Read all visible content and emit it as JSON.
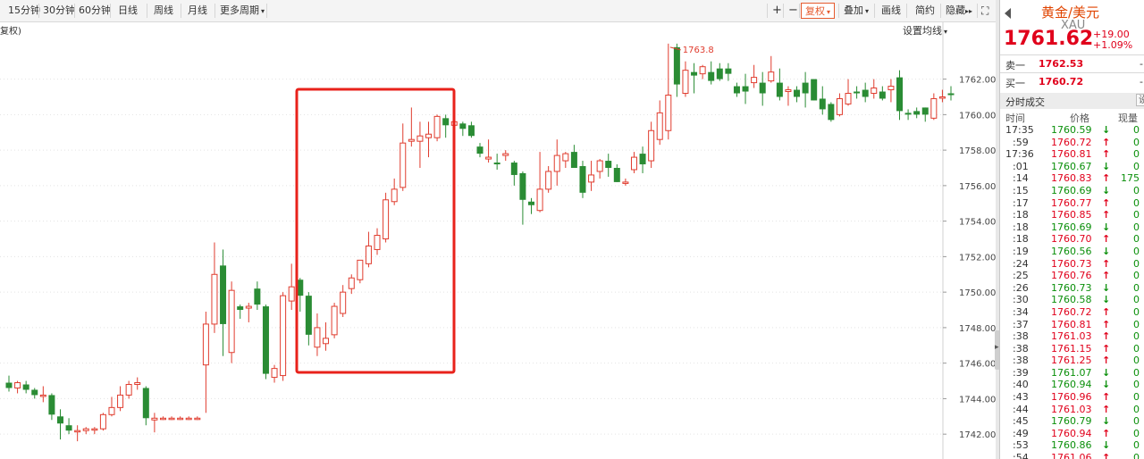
{
  "toolbar": {
    "left_tabs": [
      {
        "label": "15分钟"
      },
      {
        "label": "30分钟"
      },
      {
        "label": "60分钟"
      },
      {
        "label": "日线"
      },
      {
        "label": "周线"
      },
      {
        "label": "月线"
      },
      {
        "label": "更多周期"
      }
    ],
    "plus_label": "+",
    "minus_label": "−",
    "restore_label": "复权",
    "overlay_label": "叠加",
    "draw_label": "画线",
    "simple_label": "简约",
    "hide_label": "隐藏",
    "caret": "▾",
    "forward_glyph": "▸▸",
    "fullscreen_glyph": "⛶"
  },
  "chart": {
    "restore_tag": "复权)",
    "ma_setting": "设置均线",
    "max_label": "1763.8",
    "highlight_color": "#e8221b",
    "up_color": "#e03c2e",
    "down_color": "#2a8c34"
  },
  "chart_data": {
    "type": "candlestick",
    "y_axis": {
      "min": 1740.6,
      "max": 1765.2,
      "ticks": [
        1762,
        1760,
        1758,
        1756,
        1754,
        1752,
        1750,
        1748,
        1746,
        1744,
        1742
      ]
    },
    "ohlc": [
      [
        1744.9,
        1745.3,
        1744.4,
        1744.6
      ],
      [
        1744.6,
        1745.0,
        1744.3,
        1744.9
      ],
      [
        1744.8,
        1745.0,
        1744.3,
        1744.5
      ],
      [
        1744.5,
        1744.6,
        1744.0,
        1744.2
      ],
      [
        1744.2,
        1744.7,
        1743.8,
        1744.2
      ],
      [
        1744.2,
        1744.3,
        1742.8,
        1743.1
      ],
      [
        1743.0,
        1743.4,
        1741.7,
        1742.6
      ],
      [
        1742.5,
        1742.9,
        1742.0,
        1742.2
      ],
      [
        1742.2,
        1742.5,
        1741.6,
        1742.2
      ],
      [
        1742.2,
        1742.4,
        1742.0,
        1742.3
      ],
      [
        1742.3,
        1742.4,
        1742.0,
        1742.3
      ],
      [
        1742.3,
        1743.2,
        1742.2,
        1743.1
      ],
      [
        1743.1,
        1744.1,
        1743.0,
        1743.5
      ],
      [
        1743.5,
        1744.7,
        1743.3,
        1744.2
      ],
      [
        1744.2,
        1745.0,
        1744.0,
        1744.8
      ],
      [
        1744.8,
        1745.2,
        1744.5,
        1744.9
      ],
      [
        1744.6,
        1744.7,
        1742.5,
        1742.9
      ],
      [
        1742.8,
        1743.2,
        1742.1,
        1742.9
      ],
      [
        1742.9,
        1743.0,
        1742.8,
        1742.9
      ],
      [
        1742.9,
        1743.0,
        1742.8,
        1742.9
      ],
      [
        1742.9,
        1743.0,
        1742.8,
        1742.9
      ],
      [
        1742.9,
        1743.0,
        1742.8,
        1742.9
      ],
      [
        1742.9,
        1743.0,
        1742.8,
        1742.9
      ],
      [
        1745.9,
        1748.9,
        1743.2,
        1748.2
      ],
      [
        1748.2,
        1752.8,
        1747.7,
        1751.0
      ],
      [
        1751.5,
        1752.4,
        1746.4,
        1748.2
      ],
      [
        1746.6,
        1750.6,
        1746.0,
        1750.1
      ],
      [
        1749.2,
        1749.3,
        1748.5,
        1749.0
      ],
      [
        1749.1,
        1749.4,
        1748.3,
        1749.2
      ],
      [
        1750.2,
        1750.6,
        1749.0,
        1749.3
      ],
      [
        1749.2,
        1749.3,
        1745.1,
        1745.4
      ],
      [
        1745.2,
        1745.9,
        1744.9,
        1745.7
      ],
      [
        1745.3,
        1750.0,
        1745.0,
        1749.8
      ],
      [
        1749.5,
        1751.6,
        1749.0,
        1750.3
      ],
      [
        1750.7,
        1750.8,
        1748.9,
        1749.8
      ],
      [
        1749.8,
        1750.0,
        1747.0,
        1747.6
      ],
      [
        1746.9,
        1748.8,
        1746.4,
        1748.0
      ],
      [
        1747.1,
        1748.3,
        1746.7,
        1747.4
      ],
      [
        1747.6,
        1749.4,
        1747.4,
        1749.2
      ],
      [
        1748.8,
        1750.4,
        1748.6,
        1750.0
      ],
      [
        1750.2,
        1751.0,
        1749.9,
        1750.8
      ],
      [
        1750.7,
        1751.8,
        1750.5,
        1751.8
      ],
      [
        1751.6,
        1753.4,
        1751.4,
        1752.6
      ],
      [
        1752.4,
        1753.6,
        1752.1,
        1753.2
      ],
      [
        1753.0,
        1755.6,
        1752.8,
        1755.2
      ],
      [
        1755.1,
        1756.4,
        1754.9,
        1755.8
      ],
      [
        1755.9,
        1759.5,
        1755.7,
        1758.4
      ],
      [
        1758.5,
        1760.4,
        1758.2,
        1758.6
      ],
      [
        1758.5,
        1759.6,
        1757.0,
        1758.8
      ],
      [
        1758.7,
        1759.6,
        1757.6,
        1758.9
      ],
      [
        1758.7,
        1760.0,
        1758.5,
        1759.9
      ],
      [
        1759.8,
        1760.0,
        1758.7,
        1759.4
      ],
      [
        1759.4,
        1759.9,
        1759.0,
        1759.6
      ],
      [
        1759.5,
        1759.6,
        1758.8,
        1759.2
      ],
      [
        1759.4,
        1759.6,
        1758.7,
        1758.8
      ],
      [
        1758.2,
        1758.4,
        1757.6,
        1757.8
      ],
      [
        1757.5,
        1758.6,
        1757.3,
        1757.6
      ],
      [
        1757.3,
        1757.8,
        1756.9,
        1757.2
      ],
      [
        1757.7,
        1758.0,
        1757.4,
        1757.8
      ],
      [
        1757.3,
        1757.4,
        1756.0,
        1756.6
      ],
      [
        1756.7,
        1756.8,
        1753.8,
        1755.2
      ],
      [
        1755.1,
        1755.3,
        1754.4,
        1754.9
      ],
      [
        1754.6,
        1757.9,
        1754.5,
        1755.8
      ],
      [
        1755.8,
        1757.1,
        1755.6,
        1756.8
      ],
      [
        1756.8,
        1758.6,
        1756.0,
        1757.7
      ],
      [
        1757.4,
        1757.9,
        1757.0,
        1757.8
      ],
      [
        1757.9,
        1758.3,
        1757.0,
        1757.0
      ],
      [
        1757.1,
        1757.4,
        1755.3,
        1755.6
      ],
      [
        1756.2,
        1757.4,
        1755.7,
        1756.6
      ],
      [
        1756.8,
        1757.5,
        1756.4,
        1757.4
      ],
      [
        1757.4,
        1757.8,
        1756.5,
        1757.0
      ],
      [
        1757.0,
        1757.2,
        1756.2,
        1756.2
      ],
      [
        1756.2,
        1756.4,
        1756.0,
        1756.2
      ],
      [
        1756.9,
        1757.9,
        1756.7,
        1757.6
      ],
      [
        1757.8,
        1758.2,
        1756.7,
        1757.2
      ],
      [
        1757.4,
        1759.6,
        1757.0,
        1759.1
      ],
      [
        1758.6,
        1760.8,
        1758.3,
        1760.1
      ],
      [
        1759.1,
        1764.0,
        1758.6,
        1761.1
      ],
      [
        1763.8,
        1764.0,
        1761.0,
        1761.7
      ],
      [
        1761.2,
        1763.0,
        1761.0,
        1762.5
      ],
      [
        1762.4,
        1762.9,
        1761.2,
        1762.2
      ],
      [
        1762.3,
        1762.8,
        1762.0,
        1762.7
      ],
      [
        1762.4,
        1763.0,
        1761.7,
        1761.9
      ],
      [
        1762.6,
        1762.9,
        1761.9,
        1762.0
      ],
      [
        1762.6,
        1762.9,
        1761.9,
        1762.3
      ],
      [
        1761.6,
        1761.8,
        1761.0,
        1761.2
      ],
      [
        1761.6,
        1762.3,
        1760.6,
        1761.3
      ],
      [
        1761.8,
        1762.8,
        1761.5,
        1762.1
      ],
      [
        1761.8,
        1762.4,
        1760.5,
        1761.2
      ],
      [
        1761.9,
        1763.3,
        1761.8,
        1762.4
      ],
      [
        1761.8,
        1762.6,
        1760.8,
        1761.0
      ],
      [
        1761.3,
        1761.6,
        1760.5,
        1761.4
      ],
      [
        1761.4,
        1761.6,
        1760.7,
        1761.0
      ],
      [
        1761.8,
        1762.4,
        1760.4,
        1761.2
      ],
      [
        1762.0,
        1762.0,
        1760.8,
        1760.8
      ],
      [
        1760.9,
        1761.6,
        1760.0,
        1760.3
      ],
      [
        1760.6,
        1760.7,
        1759.6,
        1759.7
      ],
      [
        1760.0,
        1761.2,
        1759.9,
        1760.9
      ],
      [
        1760.6,
        1762.0,
        1760.5,
        1761.2
      ],
      [
        1761.3,
        1761.6,
        1760.9,
        1761.2
      ],
      [
        1761.4,
        1761.8,
        1760.7,
        1761.0
      ],
      [
        1761.2,
        1762.0,
        1760.9,
        1761.5
      ],
      [
        1761.3,
        1761.6,
        1760.8,
        1760.9
      ],
      [
        1761.4,
        1762.0,
        1760.7,
        1761.6
      ],
      [
        1762.1,
        1762.5,
        1759.7,
        1760.2
      ],
      [
        1760.1,
        1760.3,
        1759.7,
        1760.0
      ],
      [
        1760.2,
        1760.4,
        1759.8,
        1760.0
      ],
      [
        1760.4,
        1760.4,
        1759.6,
        1760.0
      ],
      [
        1759.8,
        1761.2,
        1759.7,
        1760.9
      ],
      [
        1761.0,
        1761.4,
        1760.7,
        1761.0
      ],
      [
        1761.2,
        1761.6,
        1760.8,
        1761.1
      ]
    ],
    "max_marker_value": 1763.8
  },
  "quote": {
    "name": "黄金/美元",
    "code": "XAU",
    "price": "1761.62",
    "change": "+19.00",
    "change_pct": "+1.09%",
    "sell_label": "卖一",
    "sell_price": "1762.53",
    "buy_label": "买一",
    "buy_price": "1760.72",
    "dash": "-"
  },
  "trades_panel": {
    "title": "分时成交",
    "btn": "设",
    "col_time": "时间",
    "col_price": "价格",
    "col_vol": "现量",
    "rows": [
      {
        "time": "17:35",
        "price": "1760.59",
        "dir": "down",
        "arrow": "↓",
        "vol": "0"
      },
      {
        "time": ":59",
        "price": "1760.72",
        "dir": "up",
        "arrow": "↑",
        "vol": "0"
      },
      {
        "time": "17:36",
        "price": "1760.81",
        "dir": "up",
        "arrow": "↑",
        "vol": "0"
      },
      {
        "time": ":01",
        "price": "1760.67",
        "dir": "down",
        "arrow": "↓",
        "vol": "0"
      },
      {
        "time": ":14",
        "price": "1760.83",
        "dir": "up",
        "arrow": "↑",
        "vol": "175"
      },
      {
        "time": ":15",
        "price": "1760.69",
        "dir": "down",
        "arrow": "↓",
        "vol": "0"
      },
      {
        "time": ":17",
        "price": "1760.77",
        "dir": "up",
        "arrow": "↑",
        "vol": "0"
      },
      {
        "time": ":18",
        "price": "1760.85",
        "dir": "up",
        "arrow": "↑",
        "vol": "0"
      },
      {
        "time": ":18",
        "price": "1760.69",
        "dir": "down",
        "arrow": "↓",
        "vol": "0"
      },
      {
        "time": ":18",
        "price": "1760.70",
        "dir": "up",
        "arrow": "↑",
        "vol": "0"
      },
      {
        "time": ":19",
        "price": "1760.56",
        "dir": "down",
        "arrow": "↓",
        "vol": "0"
      },
      {
        "time": ":24",
        "price": "1760.73",
        "dir": "up",
        "arrow": "↑",
        "vol": "0"
      },
      {
        "time": ":25",
        "price": "1760.76",
        "dir": "up",
        "arrow": "↑",
        "vol": "0"
      },
      {
        "time": ":26",
        "price": "1760.73",
        "dir": "down",
        "arrow": "↓",
        "vol": "0"
      },
      {
        "time": ":30",
        "price": "1760.58",
        "dir": "down",
        "arrow": "↓",
        "vol": "0"
      },
      {
        "time": ":34",
        "price": "1760.72",
        "dir": "up",
        "arrow": "↑",
        "vol": "0"
      },
      {
        "time": ":37",
        "price": "1760.81",
        "dir": "up",
        "arrow": "↑",
        "vol": "0"
      },
      {
        "time": ":38",
        "price": "1761.03",
        "dir": "up",
        "arrow": "↑",
        "vol": "0"
      },
      {
        "time": ":38",
        "price": "1761.15",
        "dir": "up",
        "arrow": "↑",
        "vol": "0"
      },
      {
        "time": ":38",
        "price": "1761.25",
        "dir": "up",
        "arrow": "↑",
        "vol": "0"
      },
      {
        "time": ":39",
        "price": "1761.07",
        "dir": "down",
        "arrow": "↓",
        "vol": "0"
      },
      {
        "time": ":40",
        "price": "1760.94",
        "dir": "down",
        "arrow": "↓",
        "vol": "0"
      },
      {
        "time": ":43",
        "price": "1760.96",
        "dir": "up",
        "arrow": "↑",
        "vol": "0"
      },
      {
        "time": ":44",
        "price": "1761.03",
        "dir": "up",
        "arrow": "↑",
        "vol": "0"
      },
      {
        "time": ":45",
        "price": "1760.79",
        "dir": "down",
        "arrow": "↓",
        "vol": "0"
      },
      {
        "time": ":49",
        "price": "1760.94",
        "dir": "up",
        "arrow": "↑",
        "vol": "0"
      },
      {
        "time": ":53",
        "price": "1760.86",
        "dir": "down",
        "arrow": "↓",
        "vol": "0"
      },
      {
        "time": ":54",
        "price": "1761.06",
        "dir": "up",
        "arrow": "↑",
        "vol": "0"
      }
    ]
  }
}
